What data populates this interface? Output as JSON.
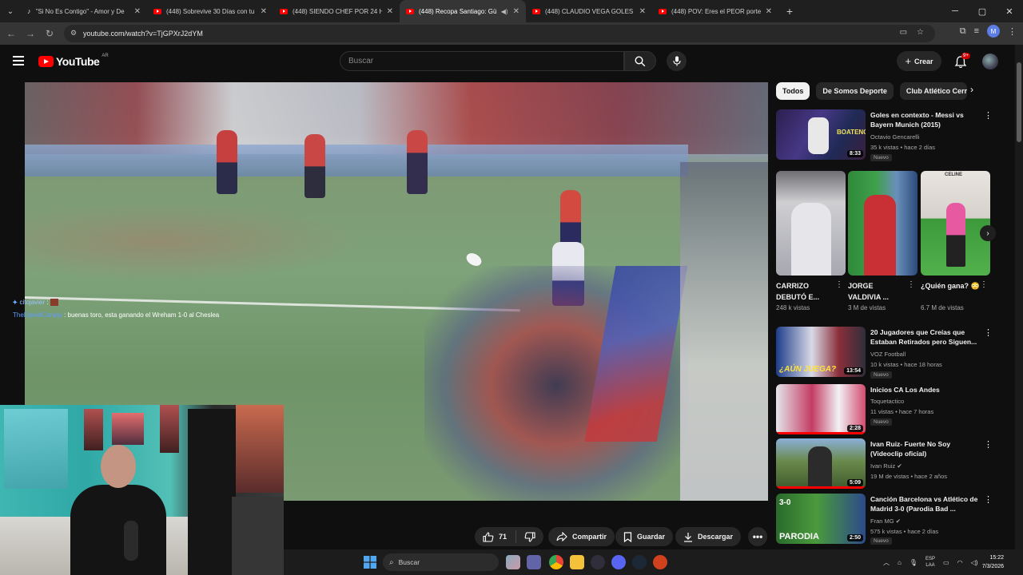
{
  "browser": {
    "tabs": [
      {
        "title": "\"Si No Es Contigo\" - Amor y De",
        "active": false
      },
      {
        "title": "(448) Sobrevive 30 Días con tu",
        "active": false
      },
      {
        "title": "(448) SIENDO CHEF POR 24 HO",
        "active": false
      },
      {
        "title": "(448) Recopa Santiago: Gü",
        "active": true
      },
      {
        "title": "(448) CLAUDIO VEGA GOLES R",
        "active": false
      },
      {
        "title": "(448) POV: Eres el PEOR porter",
        "active": false
      }
    ],
    "url": "youtube.com/watch?v=TjGPXrJ2dYM",
    "profile_initial": "M"
  },
  "youtube": {
    "logo_text": "YouTube",
    "country_code": "AR",
    "search_placeholder": "Buscar",
    "create_label": "Crear",
    "notif_badge": "9+"
  },
  "chat_overlay": {
    "user1": "citojavier",
    "user2": "TheDanielCanejo",
    "message": ": buenas toro, esta ganando el Wreham 1-0 al Cheslea"
  },
  "actions": {
    "likes": "71",
    "share": "Compartir",
    "save": "Guardar",
    "download": "Descargar"
  },
  "chips": [
    "Todos",
    "De Somos Deporte",
    "Club Atlético Cerro"
  ],
  "recommendations_top": [
    {
      "title": "Goles en contexto - Messi vs Bayern Munich (2015)",
      "channel": "Octavio Gencarelli",
      "meta": "35 k vistas • hace 2 días",
      "badge": "Nuevo",
      "duration": "8:33",
      "verified": false
    }
  ],
  "shorts": [
    {
      "title": "CARRIZO DEBUTÓ E...",
      "views": "248 k vistas"
    },
    {
      "title": "JORGE VALDIVIA ...",
      "views": "3 M de vistas"
    },
    {
      "title": "¿Quién gana? 😳",
      "views": "6.7 M de vistas",
      "overlay": "CELINE"
    }
  ],
  "recommendations": [
    {
      "title": "20 Jugadores que Creías que Estaban Retirados pero Siguen...",
      "channel": "VOZ Football",
      "meta": "10 k vistas • hace 18 horas",
      "badge": "Nuevo",
      "duration": "13:54",
      "thumb_text": "¿AÚN JUEGA?",
      "verified": false,
      "progress": 0
    },
    {
      "title": "Inicios CA Los Andes",
      "channel": "Toquetactico",
      "meta": "11 vistas • hace 7 horas",
      "badge": "Nuevo",
      "duration": "2:28",
      "verified": false,
      "progress": 1
    },
    {
      "title": "Ivan Ruiz- Fuerte No Soy (Videoclip oficial)",
      "channel": "Ivan Ruiz",
      "meta": "19 M de vistas • hace 2 años",
      "badge": "",
      "duration": "5:09",
      "verified": true,
      "progress": 1
    },
    {
      "title": "Canción Barcelona vs Atlético de Madrid 3-0 (Parodia Bad ...",
      "channel": "Fran MG",
      "meta": "575 k vistas • hace 2 días",
      "badge": "Nuevo",
      "duration": "2:50",
      "thumb_text": "PARODIA",
      "thumb_score": "3-0",
      "verified": true,
      "progress": 0
    }
  ],
  "taskbar": {
    "search_placeholder": "Buscar",
    "lang_top": "ESP",
    "lang_bottom": "LAA",
    "time": "15:22",
    "date": "7/3/2026"
  },
  "colors": {
    "accent_red": "#ff0000",
    "background": "#0f0f0f",
    "chip_bg": "#272727"
  }
}
